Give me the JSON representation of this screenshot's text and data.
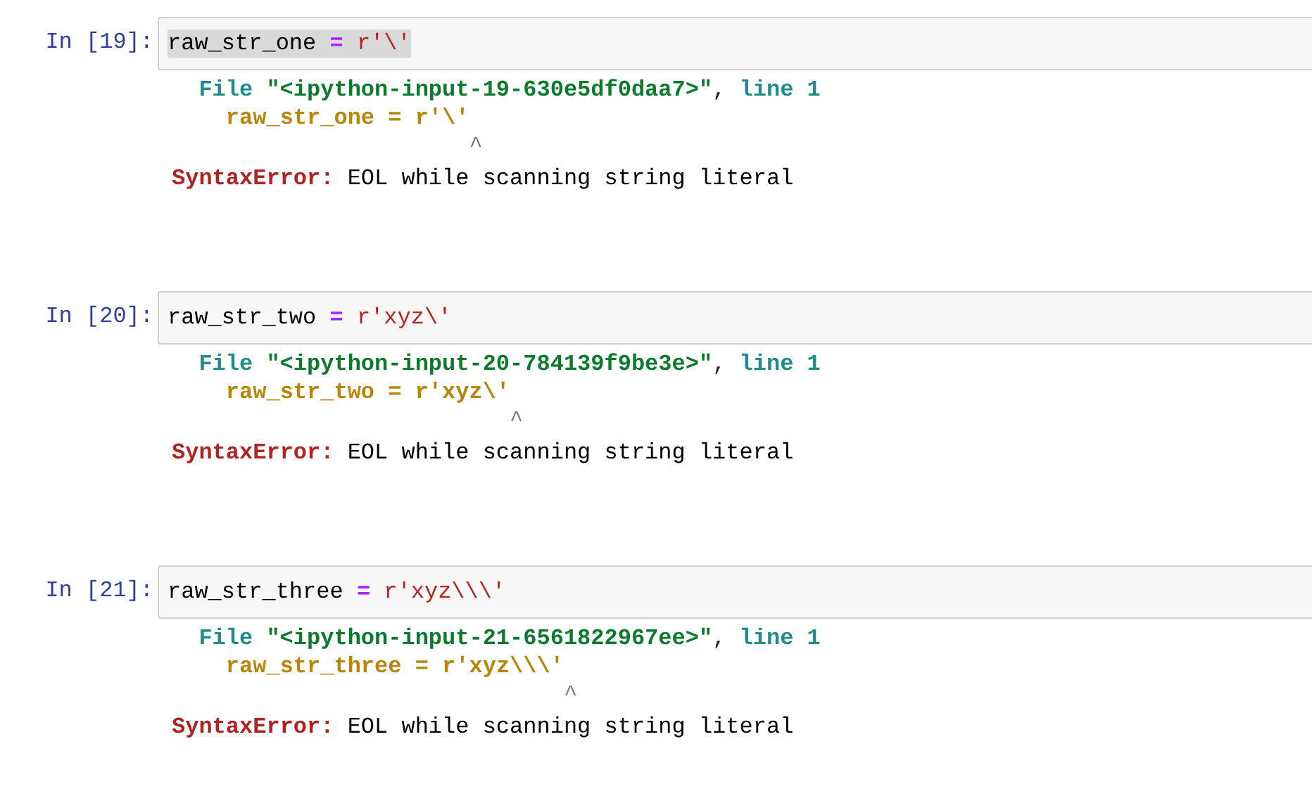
{
  "cells": [
    {
      "prompt": "In [19]:",
      "highlighted": true,
      "code": [
        {
          "kind": "name",
          "text": "raw_str_one"
        },
        {
          "kind": "op",
          "text": "="
        },
        {
          "kind": "string",
          "text": "r'\\'"
        }
      ],
      "traceback": {
        "file_word": "File",
        "file_path": "\"<ipython-input-19-630e5df0daa7>\"",
        "separator": ",",
        "line_label": "line 1",
        "source": "raw_str_one = r'\\'",
        "caret": "                  ^",
        "error_name": "SyntaxError:",
        "error_message": "EOL while scanning string literal"
      }
    },
    {
      "prompt": "In [20]:",
      "highlighted": false,
      "code": [
        {
          "kind": "name",
          "text": "raw_str_two"
        },
        {
          "kind": "op",
          "text": "="
        },
        {
          "kind": "string",
          "text": "r'xyz\\'"
        }
      ],
      "traceback": {
        "file_word": "File",
        "file_path": "\"<ipython-input-20-784139f9be3e>\"",
        "separator": ",",
        "line_label": "line 1",
        "source": "raw_str_two = r'xyz\\'",
        "caret": "                     ^",
        "error_name": "SyntaxError:",
        "error_message": "EOL while scanning string literal"
      }
    },
    {
      "prompt": "In [21]:",
      "highlighted": false,
      "code": [
        {
          "kind": "name",
          "text": "raw_str_three"
        },
        {
          "kind": "op",
          "text": "="
        },
        {
          "kind": "string",
          "text": "r'xyz\\\\\\'"
        }
      ],
      "traceback": {
        "file_word": "File",
        "file_path": "\"<ipython-input-21-6561822967ee>\"",
        "separator": ",",
        "line_label": "line 1",
        "source": "raw_str_three = r'xyz\\\\\\'",
        "caret": "                         ^",
        "error_name": "SyntaxError:",
        "error_message": "EOL while scanning string literal"
      }
    }
  ]
}
